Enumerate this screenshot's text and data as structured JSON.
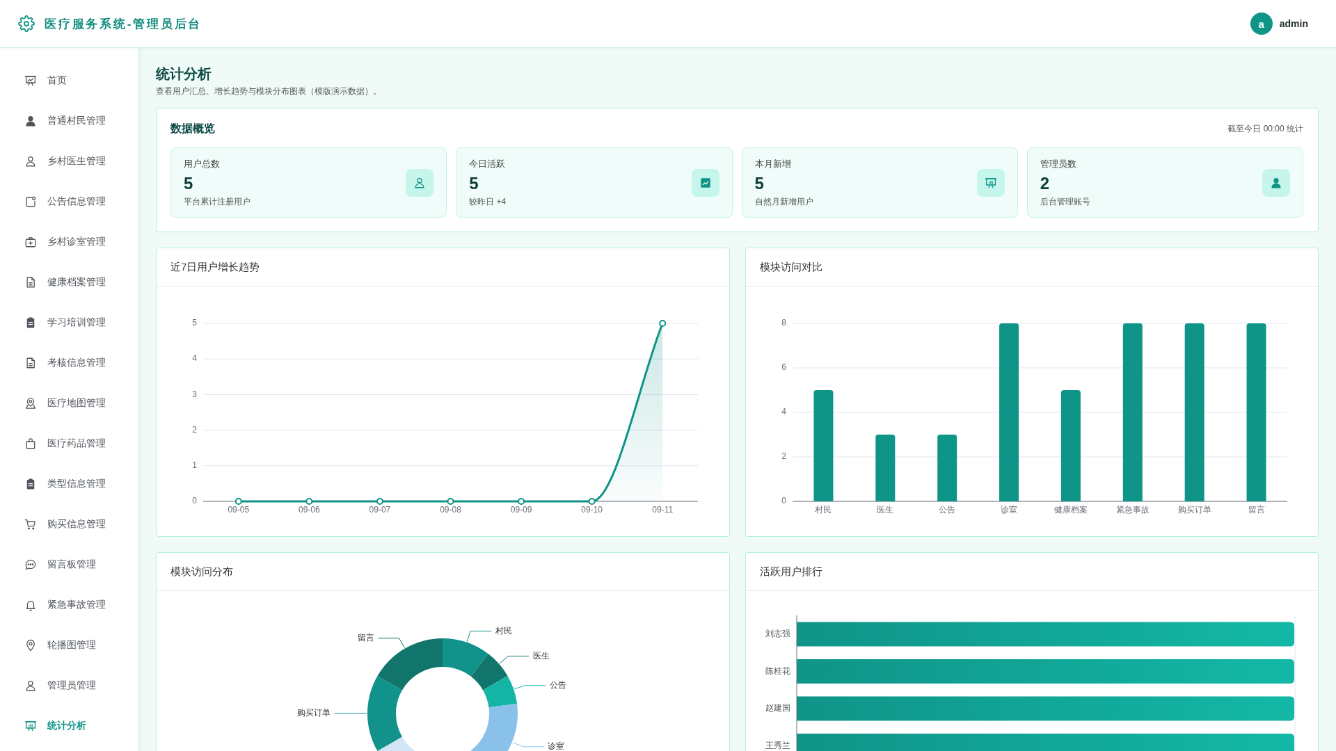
{
  "header": {
    "title": "医疗服务系统-管理员后台",
    "user": {
      "avatar": "a",
      "name": "admin"
    }
  },
  "sidebar": {
    "items": [
      {
        "label": "首页",
        "selected": false
      },
      {
        "label": "普通村民管理",
        "selected": false
      },
      {
        "label": "乡村医生管理",
        "selected": false
      },
      {
        "label": "公告信息管理",
        "selected": false
      },
      {
        "label": "乡村诊室管理",
        "selected": false
      },
      {
        "label": "健康档案管理",
        "selected": false
      },
      {
        "label": "学习培训管理",
        "selected": false
      },
      {
        "label": "考核信息管理",
        "selected": false
      },
      {
        "label": "医疗地图管理",
        "selected": false
      },
      {
        "label": "医疗药品管理",
        "selected": false
      },
      {
        "label": "类型信息管理",
        "selected": false
      },
      {
        "label": "购买信息管理",
        "selected": false
      },
      {
        "label": "留言板管理",
        "selected": false
      },
      {
        "label": "紧急事故管理",
        "selected": false
      },
      {
        "label": "轮播图管理",
        "selected": false
      },
      {
        "label": "管理员管理",
        "selected": false
      },
      {
        "label": "统计分析",
        "selected": true
      }
    ]
  },
  "page": {
    "title": "统计分析",
    "subtitle": "查看用户汇总、增长趋势与模块分布图表（模版演示数据）。"
  },
  "overview": {
    "title": "数据概览",
    "timestamp": "截至今日 00:00 统计",
    "stats": [
      {
        "label": "用户总数",
        "value": "5",
        "note": "平台累计注册用户"
      },
      {
        "label": "今日活跃",
        "value": "5",
        "note": "较昨日 +4"
      },
      {
        "label": "本月新增",
        "value": "5",
        "note": "自然月新增用户"
      },
      {
        "label": "管理员数",
        "value": "2",
        "note": "后台管理账号"
      }
    ]
  },
  "growth_chart": {
    "chart_data": {
      "type": "line",
      "title": "近7日用户增长趋势",
      "categories": [
        "09-05",
        "09-06",
        "09-07",
        "09-08",
        "09-09",
        "09-10",
        "09-11"
      ],
      "values": [
        0,
        0,
        0,
        0,
        0,
        0,
        5
      ],
      "ylim": [
        0,
        5
      ],
      "yticks": [
        0,
        1,
        2,
        3,
        4,
        5
      ],
      "grid": true,
      "marker": "circle"
    }
  },
  "module_chart": {
    "chart_data": {
      "type": "bar",
      "title": "模块访问对比",
      "categories": [
        "村民",
        "医生",
        "公告",
        "诊室",
        "健康档案",
        "紧急事故",
        "购买订单",
        "留言"
      ],
      "values": [
        5,
        3,
        3,
        8,
        5,
        8,
        8,
        8
      ],
      "ylim": [
        0,
        8
      ],
      "yticks": [
        0,
        2,
        4,
        6,
        8
      ],
      "grid": true
    }
  },
  "distribution": {
    "title": "模块访问分布",
    "labels": [
      "村民",
      "医生",
      "公告",
      "诊室",
      "购买订单",
      "留言"
    ]
  },
  "ranking": {
    "title": "活跃用户排行",
    "users": [
      "刘志强",
      "陈桂花",
      "赵建国",
      "王秀兰"
    ]
  }
}
